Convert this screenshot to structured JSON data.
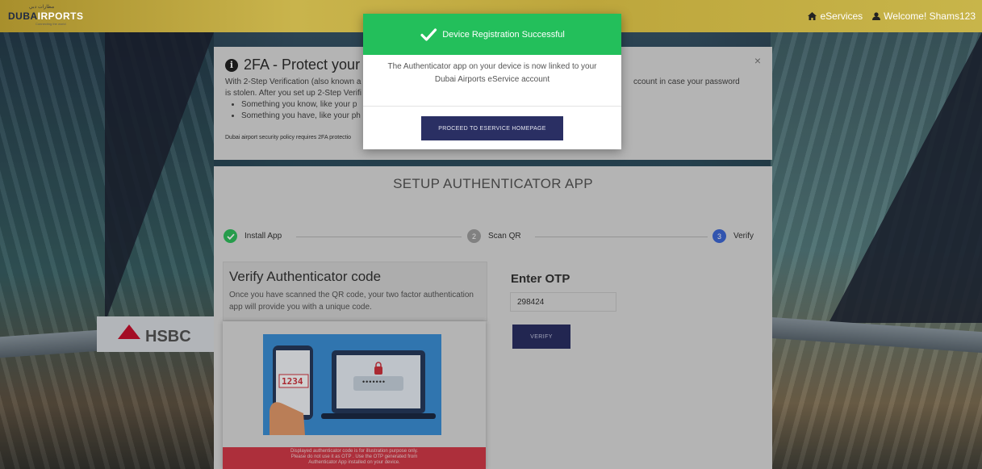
{
  "header": {
    "logo_arabic": "مطارات دبي",
    "logo_main_a": "DUBA",
    "logo_main_b": "IRPORTS",
    "logo_sub": "Connecting the world",
    "nav_eservices": "eServices",
    "nav_welcome": "Welcome! Shams123"
  },
  "info_card": {
    "title": "2FA - Protect your a",
    "body_left_line1": "With 2-Step Verification (also known a",
    "body_right_line1": "ccount in case your password",
    "body_line2": "is stolen. After you set up 2-Step Verifi",
    "bullet1": "Something you know, like your p",
    "bullet2": "Something you have, like your ph",
    "note": "Dubai airport security policy requires 2FA protectio",
    "close": "×"
  },
  "setup": {
    "title": "SETUP AUTHENTICATOR APP",
    "steps": [
      {
        "number": "✓",
        "label": "Install App",
        "state": "done",
        "color": "#2fbf5c"
      },
      {
        "number": "2",
        "label": "Scan QR",
        "state": "pending",
        "color": "#9e9e9e"
      },
      {
        "number": "3",
        "label": "Verify",
        "state": "active",
        "color": "#3d68d6"
      }
    ],
    "verify_heading": "Verify Authenticator code",
    "verify_text": "Once you have scanned the QR code, your two factor authentication app will provide you with a unique code.",
    "illustration_code": "1234",
    "illustration_password": "•••••••",
    "warning_line1": "Displayed authenticator code is for illustration purpose only.",
    "warning_line2": "Please do not use it as OTP . Use the OTP generated from",
    "warning_line3": "Authenticator App installed on your device.",
    "otp_label": "Enter OTP",
    "otp_value": "298424",
    "verify_button": "VERIFY"
  },
  "modal": {
    "title": "Device Registration Successful",
    "message_line1": "The Authenticator app on your device is now linked to your",
    "message_line2": "Dubai Airports eService account",
    "button": "PROCEED TO ESERVICE HOMEPAGE",
    "header_color": "#23bf5b"
  },
  "background": {
    "sign_text": "HSBC"
  }
}
